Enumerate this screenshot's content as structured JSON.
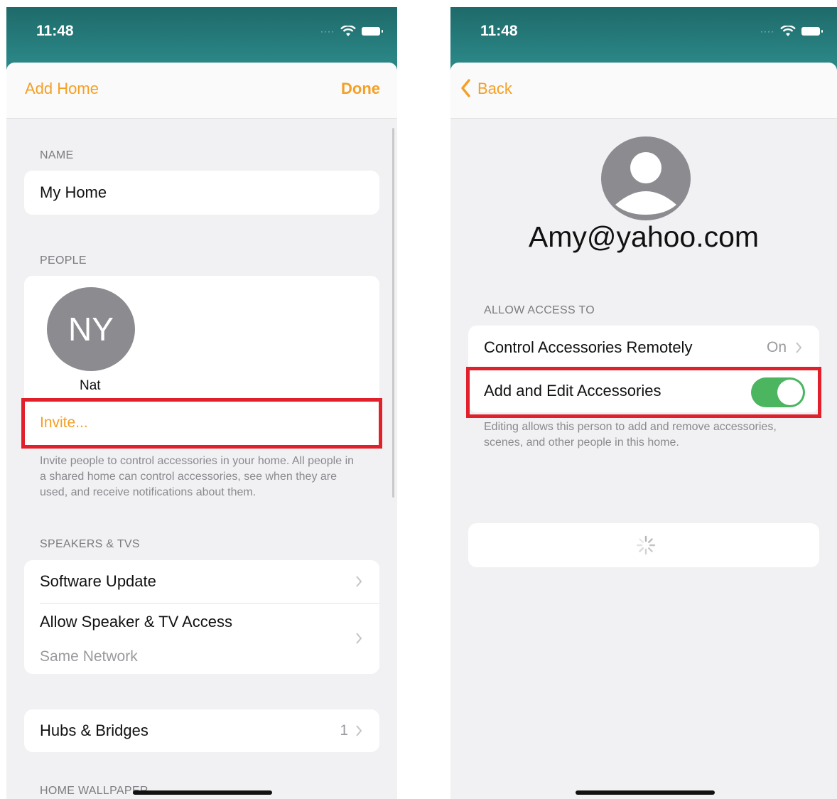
{
  "left_screen": {
    "time": "11:48",
    "nav": {
      "left": "Add Home",
      "right": "Done"
    },
    "name_section": {
      "header": "NAME",
      "value": "My Home"
    },
    "people_section": {
      "header": "PEOPLE",
      "avatar_initials": "NY",
      "person_name": "Nat",
      "invite_label": "Invite...",
      "footer": "Invite people to control accessories in your home. All people in a shared home can control accessories, see when they are used, and receive notifications about them."
    },
    "speakers_section": {
      "header": "SPEAKERS & TVS",
      "software_update": "Software Update",
      "allow_access": "Allow Speaker & TV Access",
      "allow_access_value": "Same Network"
    },
    "hubs": {
      "label": "Hubs & Bridges",
      "count": "1"
    },
    "wallpaper_header": "HOME WALLPAPER"
  },
  "right_screen": {
    "time": "11:48",
    "nav": {
      "back": "Back"
    },
    "email": "Amy@yahoo.com",
    "access_section": {
      "header": "ALLOW ACCESS TO",
      "remote_label": "Control Accessories Remotely",
      "remote_value": "On",
      "edit_label": "Add and Edit Accessories",
      "edit_enabled": true,
      "footer": "Editing allows this person to add and remove accessories, scenes, and other people in this home."
    }
  },
  "colors": {
    "accent": "#f4a025",
    "status_bar": "#2c8b8a",
    "toggle_on": "#4bb560",
    "highlight": "#e1202b"
  }
}
